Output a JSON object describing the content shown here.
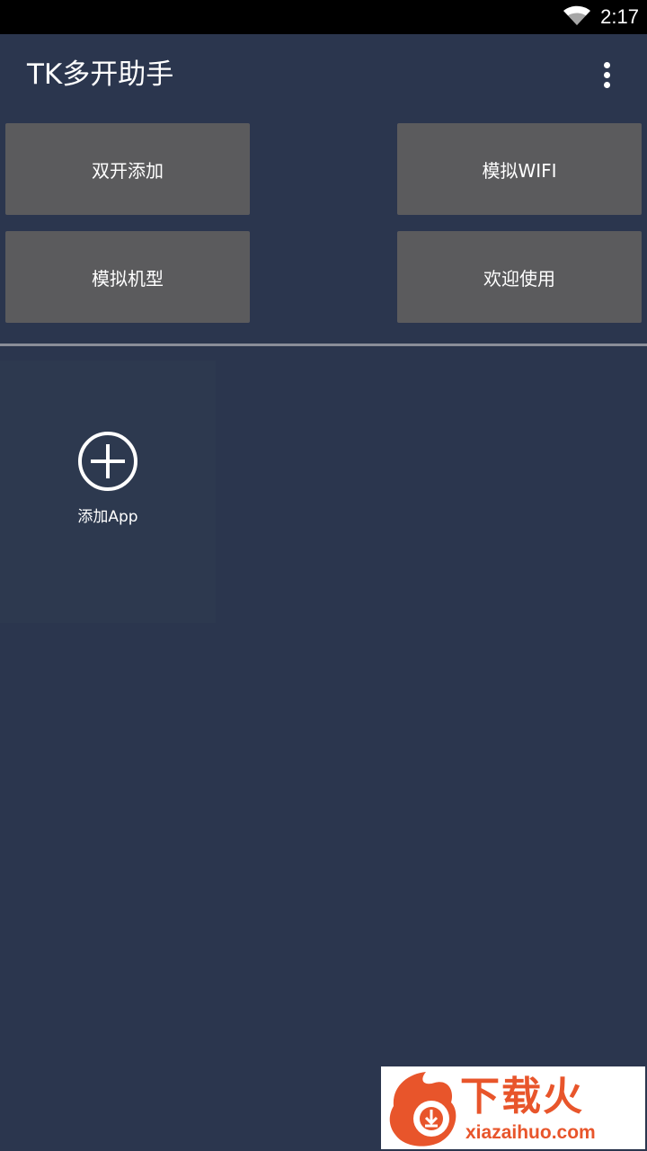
{
  "status_bar": {
    "time": "2:17",
    "wifi_icon": "wifi-icon"
  },
  "app_bar": {
    "title": "TK多开助手",
    "overflow_icon": "more-vert-icon"
  },
  "actions": [
    {
      "label": "双开添加"
    },
    {
      "label": "模拟WIFI"
    },
    {
      "label": "模拟机型"
    },
    {
      "label": "欢迎使用"
    }
  ],
  "app_list": {
    "add_tile": {
      "label": "添加App",
      "icon": "add-circle-icon"
    }
  },
  "ad": {
    "logo_text": "下载火",
    "site_text": "xiazaihuo.com",
    "logo_icon": "flame-download-icon"
  },
  "colors": {
    "background": "#2b364e",
    "status_bar": "#000000",
    "button": "#5b5b5d",
    "divider": "#8a8e98",
    "ad_accent": "#e8552b"
  }
}
